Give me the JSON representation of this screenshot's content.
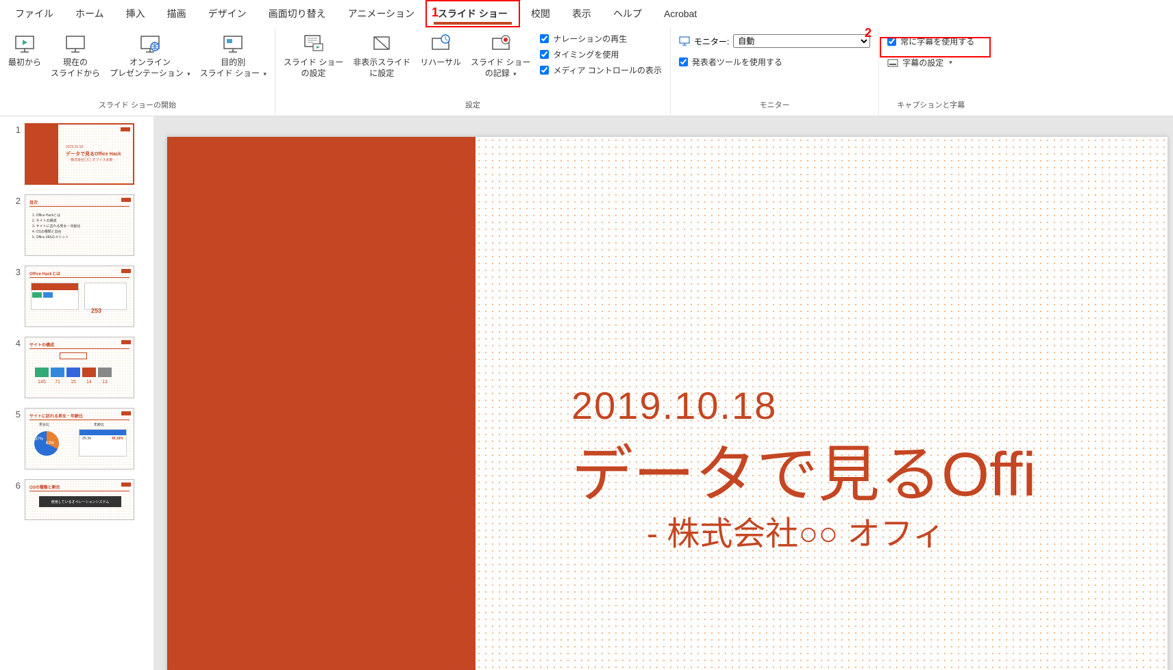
{
  "annotations": {
    "a1": "1",
    "a2": "2"
  },
  "tabs": {
    "file": "ファイル",
    "home": "ホーム",
    "insert": "挿入",
    "draw": "描画",
    "design": "デザイン",
    "transitions": "画面切り替え",
    "animations": "アニメーション",
    "slideshow": "スライド ショー",
    "review": "校閲",
    "view": "表示",
    "help": "ヘルプ",
    "acrobat": "Acrobat"
  },
  "ribbon": {
    "start": {
      "from_beginning": "最初から",
      "from_current": "現在の\nスライドから",
      "online": "オンライン\nプレゼンテーション",
      "custom": "目的別\nスライド ショー",
      "group_label": "スライド ショーの開始"
    },
    "setup": {
      "setup_show": "スライド ショー\nの設定",
      "hide_slide": "非表示スライド\nに設定",
      "rehearse": "リハーサル",
      "record": "スライド ショー\nの記録",
      "narration": "ナレーションの再生",
      "timings": "タイミングを使用",
      "media_controls": "メディア コントロールの表示",
      "group_label": "設定"
    },
    "monitor": {
      "monitor_label": "モニター:",
      "monitor_value": "自動",
      "presenter": "発表者ツールを使用する",
      "group_label": "モニター"
    },
    "caption": {
      "always_subtitles": "常に字幕を使用する",
      "subtitle_settings": "字幕の設定",
      "group_label": "キャプションと字幕"
    }
  },
  "thumbs": {
    "s1_date": "2019.10.18",
    "s1_title": "データで見るOffice Hack",
    "s1_sub": "- 株式会社〇〇 オフィス太郎 -",
    "s2_title": "目次",
    "s2_l1": "1. Office Hackとは",
    "s2_l2": "2. サイトの構成",
    "s2_l3": "3. サイトに訪れる男女・年齢比",
    "s2_l4": "4. OSの種類と割合",
    "s2_l5": "5. Office 365のメリット",
    "s3_title": "Office Hackとは",
    "s3_val": "253",
    "s4_title": "サイトの構成",
    "s4_v1": "145",
    "s4_v2": "71",
    "s4_v3": "15",
    "s4_v4": "14",
    "s4_v5": "13",
    "s5_title": "サイトに訪れる男女・年齢比",
    "s5_h1": "男女比",
    "s5_h2": "年齢比",
    "s5_pct1": "37%",
    "s5_pct2": "63%",
    "s5_age": "25-34",
    "s5_agev": "45.18%",
    "s6_title": "OSの種類と割合",
    "s6_sub": "使用しているオペレーションシステム"
  },
  "slide": {
    "date": "2019.10.18",
    "title": "データで見るOffi",
    "sub": "- 株式会社○○ オフィ"
  }
}
